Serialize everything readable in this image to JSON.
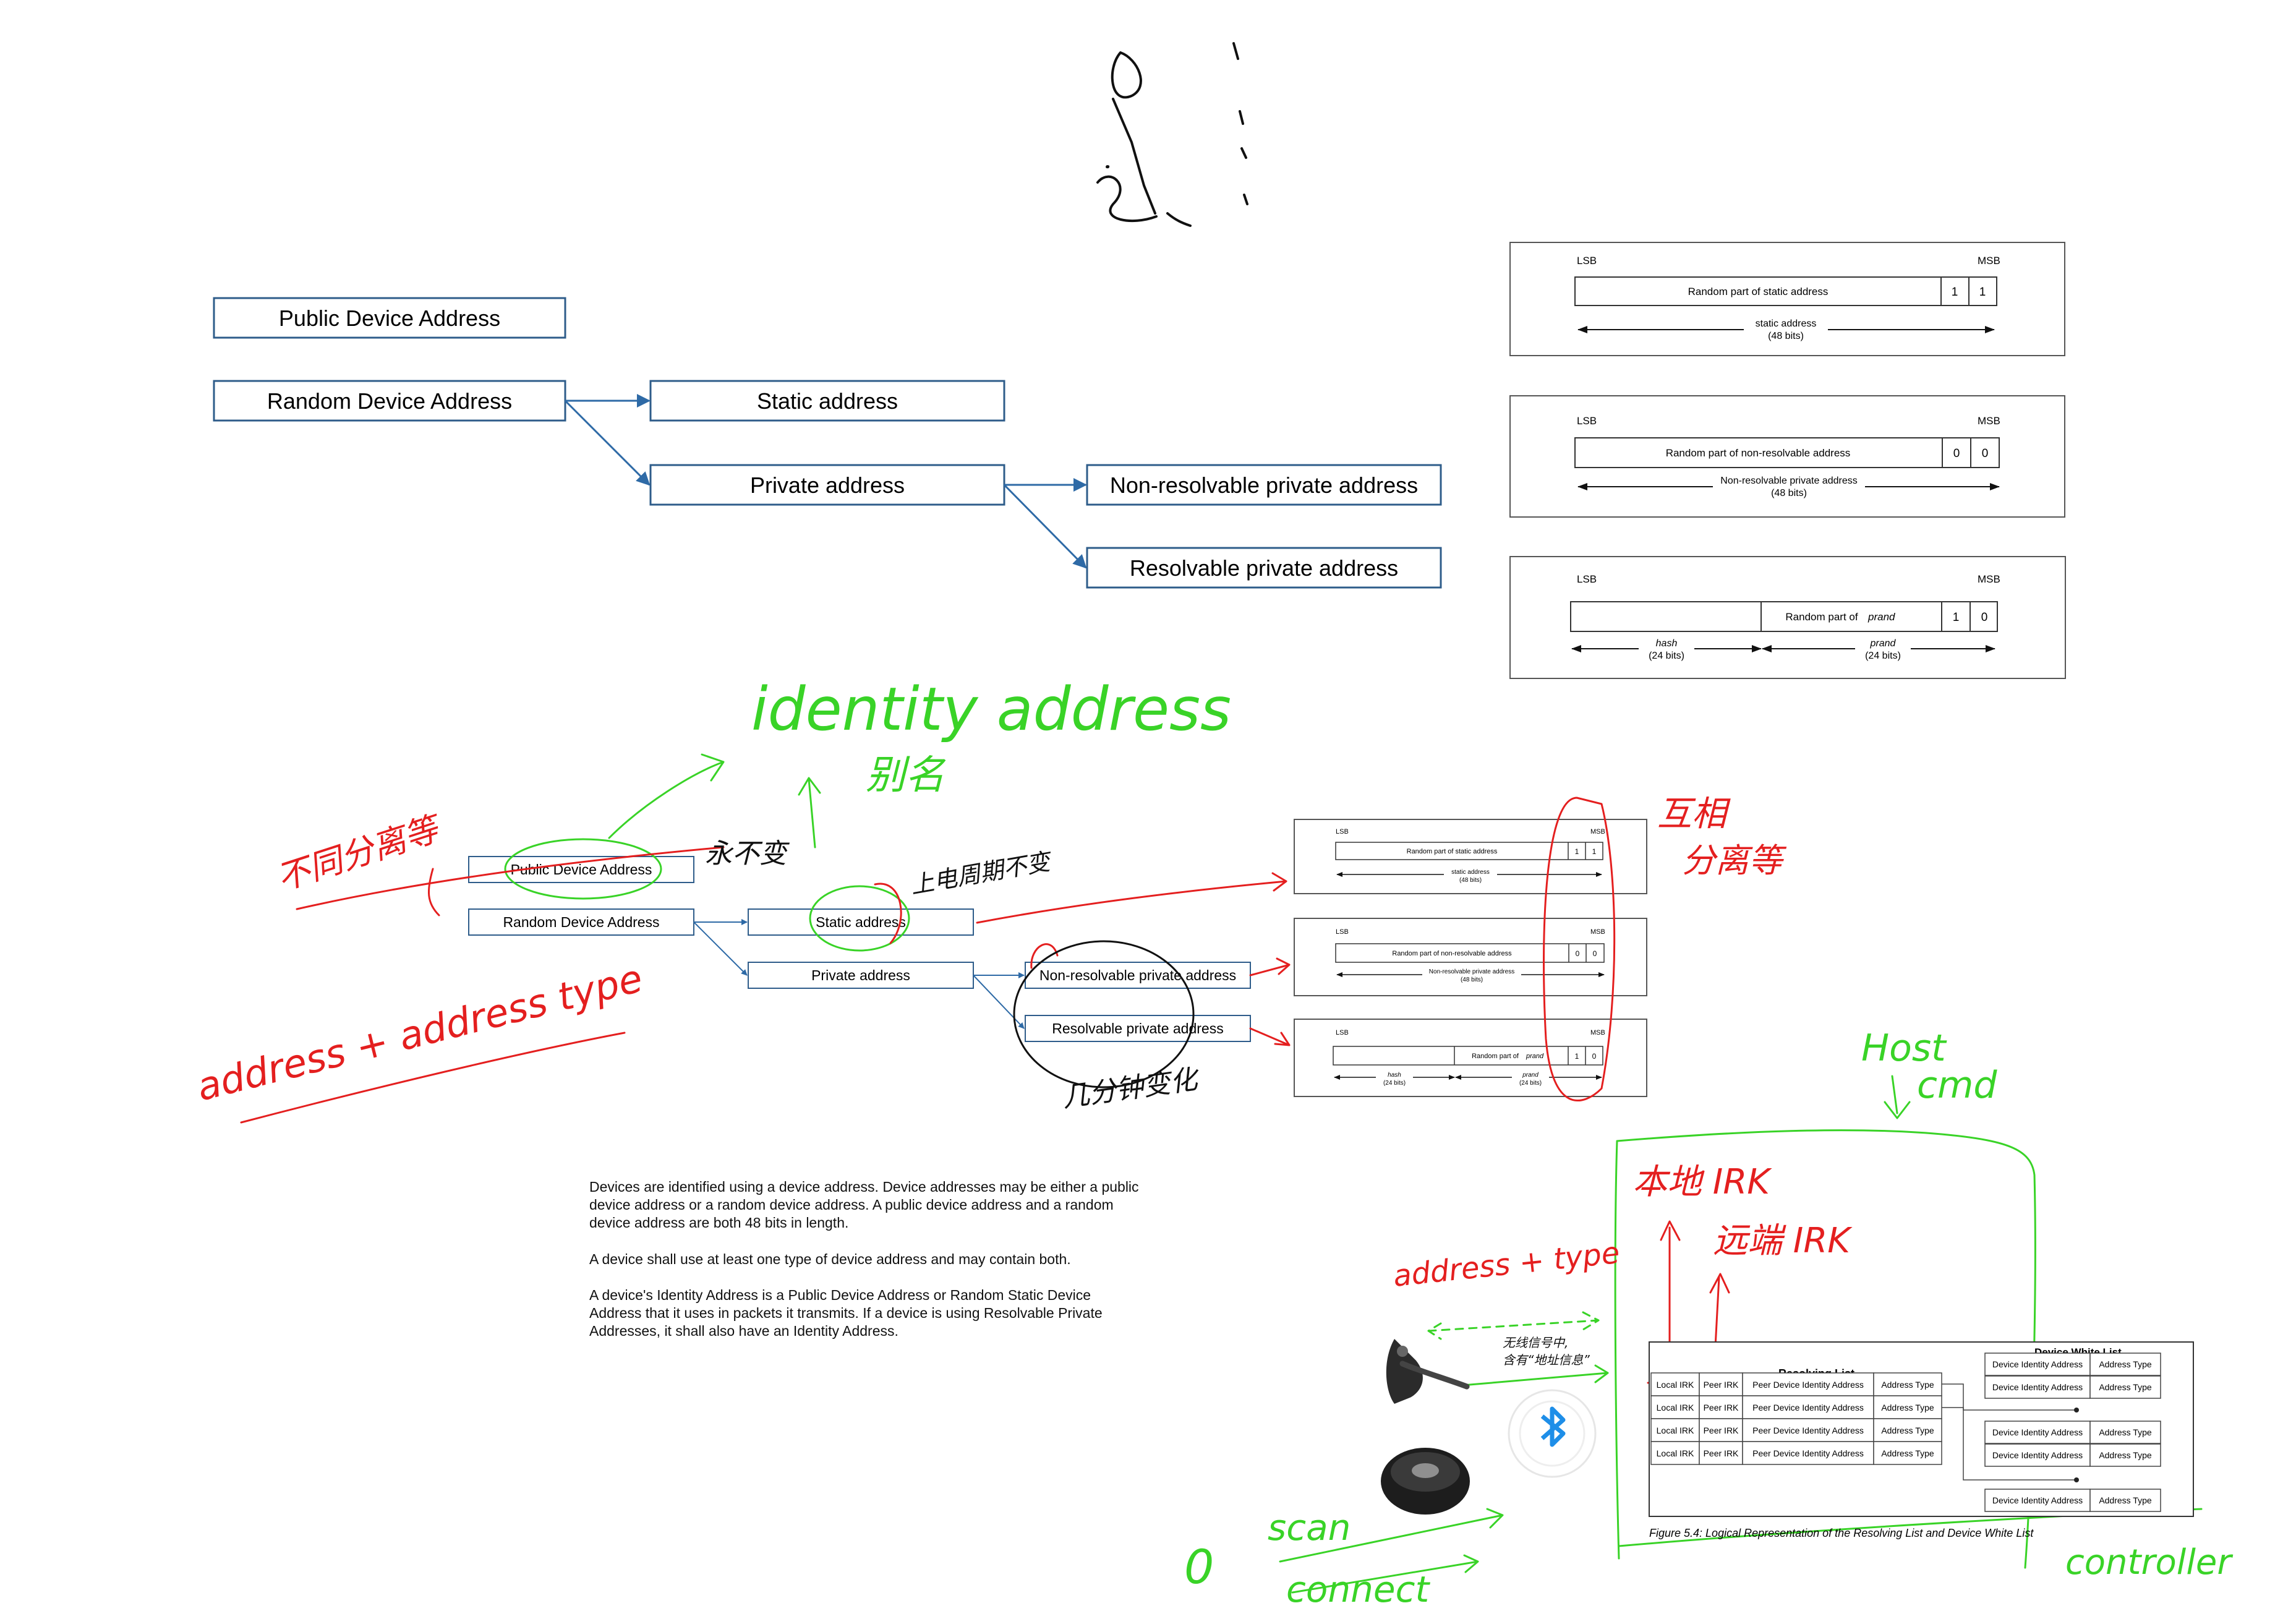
{
  "title_scribble": "标识",
  "diagram_large": {
    "public": "Public Device Address",
    "random": "Random Device Address",
    "static": "Static address",
    "private": "Private address",
    "nonres": "Non-resolvable private address",
    "res": "Resolvable private address"
  },
  "diagram_small": {
    "public": "Public Device Address",
    "random": "Random Device Address",
    "static": "Static address",
    "private": "Private address",
    "nonres": "Non-resolvable private address",
    "res": "Resolvable private address"
  },
  "bitfields": {
    "lsb": "LSB",
    "msb": "MSB",
    "static_field": "Random part of static address",
    "static_span": "static address",
    "nonres_field": "Random part of non-resolvable address",
    "nonres_span": "Non-resolvable private address",
    "bits48": "(48 bits)",
    "hash": "hash",
    "prand": "prand",
    "random_part_of": "Random part of",
    "bits24": "(24 bits)",
    "one": "1",
    "zero": "0"
  },
  "annotations": {
    "identity_address": "identity address",
    "bieming": "别名",
    "butong": "不同分离等",
    "yongbubian": "永不变",
    "shangdian": "上电周期不变",
    "jifenzhong": "几分钟变化",
    "huxiang": "互相",
    "fenli": "分离等",
    "address_type": "address + address type",
    "address_plus_type": "address + type",
    "host": "Host",
    "cmd": "cmd",
    "local_irk": "本地 IRK",
    "remote_irk": "远端 IRK",
    "scan": "scan",
    "connect": "connect",
    "controller": "controller",
    "zero_mark": "0"
  },
  "paragraphs": [
    "Devices are identified using a device address. Device addresses may be either a public device address or a random device address. A public device address and a random device address are both 48 bits in length.",
    "A device shall use at least one type of device address and may contain both.",
    "A device's Identity Address is a Public Device Address or Random Static Device Address that it uses in packets it transmits. If a device is using Resolvable Private Addresses, it shall also have an Identity Address."
  ],
  "signal_note": [
    "无线信号中,",
    "含有“地址信息”"
  ],
  "resolving": {
    "title": "Resolving List",
    "white_title": "Device White List",
    "cols": [
      "Local IRK",
      "Peer IRK",
      "Peer Device Identity Address",
      "Address Type"
    ],
    "white_cols": [
      "Device Identity Address",
      "Address Type"
    ],
    "caption": "Figure 5.4:  Logical Representation of the Resolving List and Device White List"
  },
  "colors": {
    "box_border": "#2e5c8a",
    "arrow": "#2e6aa6",
    "green": "#39d327",
    "red": "#e41f1f",
    "bluetooth": "#1e8ee8"
  },
  "icons": [
    "headset-icon",
    "bluetooth-icon",
    "speakerphone-icon"
  ]
}
